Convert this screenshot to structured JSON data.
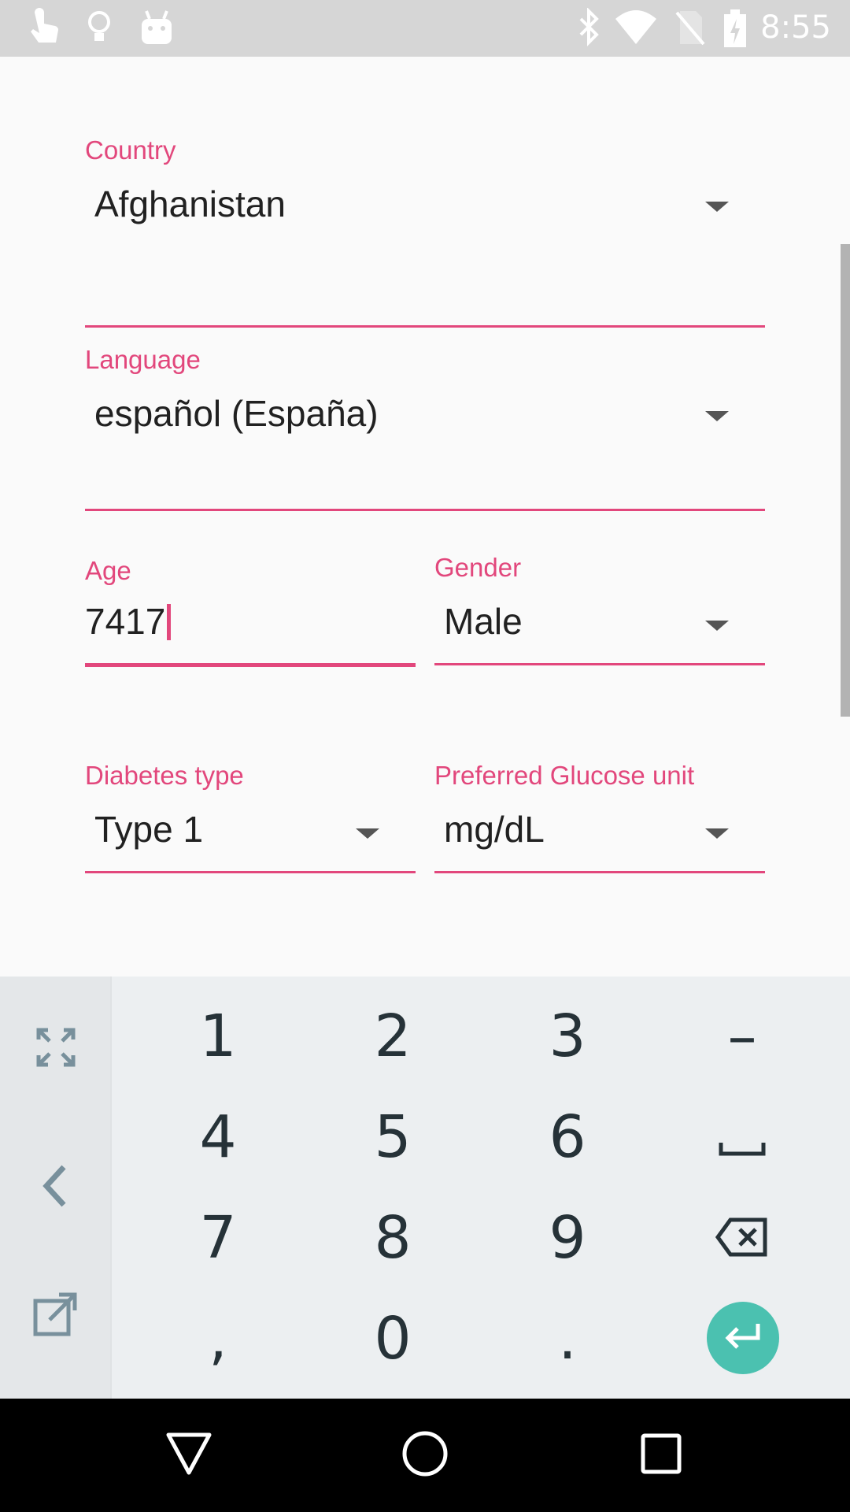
{
  "status_bar": {
    "time": "8:55",
    "left_icons": [
      "touch-app-icon",
      "lightbulb-icon",
      "android-icon"
    ],
    "right_icons": [
      "bluetooth-icon",
      "wifi-icon",
      "no-sim-icon",
      "battery-charging-icon"
    ]
  },
  "form": {
    "country": {
      "label": "Country",
      "value": "Afghanistan"
    },
    "language": {
      "label": "Language",
      "value": "español (España)"
    },
    "age": {
      "label": "Age",
      "value": "7417"
    },
    "gender": {
      "label": "Gender",
      "value": "Male"
    },
    "diabetes_type": {
      "label": "Diabetes type",
      "value": "Type 1"
    },
    "glucose_unit": {
      "label": "Preferred Glucose unit",
      "value": "mg/dL"
    }
  },
  "keyboard": {
    "rows": [
      [
        "1",
        "2",
        "3",
        "–"
      ],
      [
        "4",
        "5",
        "6",
        "␣"
      ],
      [
        "7",
        "8",
        "9",
        "⌫"
      ],
      [
        ",",
        "0",
        ".",
        "↵"
      ]
    ],
    "side_icons": [
      "fullscreen-icon",
      "back-arrow-icon",
      "open-external-icon"
    ]
  },
  "colors": {
    "accent": "#e2477c",
    "enter_key": "#4bc1b0",
    "status_bar": "#d6d6d6",
    "nav_bar": "#000000"
  }
}
